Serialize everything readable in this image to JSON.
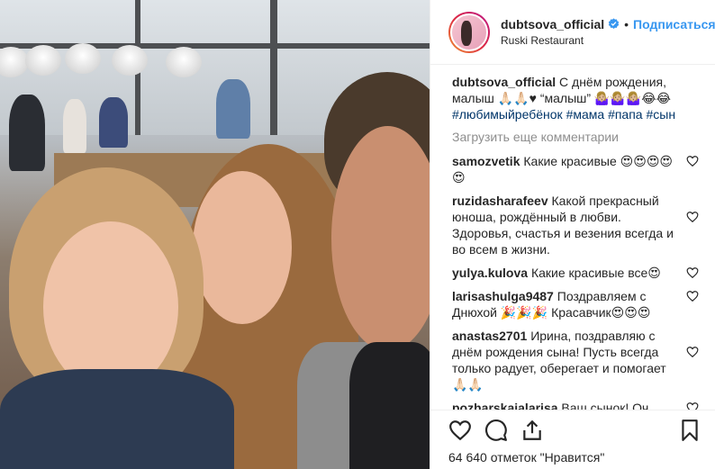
{
  "post": {
    "username": "dubtsova_official",
    "follow_label": "Подписаться",
    "location": "Ruski Restaurant",
    "dot": "•"
  },
  "caption": {
    "username": "dubtsova_official",
    "text": "С днём рождения, малыш 🙏🏻🙏🏻♥ “малыш” 🤷🏼‍♀️🤷🏼‍♀️🤷🏼‍♀️😂😂",
    "hashtags": [
      "#любимыйребёнок",
      "#мама",
      "#папа",
      "#сын"
    ]
  },
  "load_more": "Загрузить еще комментарии",
  "comments": [
    {
      "user": "samozvetik",
      "text": "Какие красивые 😍😍😍😍😍"
    },
    {
      "user": "ruzidasharafeev",
      "text": "Какой прекрасный юноша, рождённый в любви. Здоровья, счастья и везения всегда и во всем в жизни."
    },
    {
      "user": "yulya.kulova",
      "text": "Какие красивые все😍"
    },
    {
      "user": "larisashulga9487",
      "text": "Поздравляем с Днюхой 🎉🎉🎉 Красавчик😍😍😍"
    },
    {
      "user": "anastas2701",
      "text": "Ирина, поздравляю с днём рождения сына! Пусть всегда только радует, оберегает и помогает 🙏🏻🙏🏻"
    },
    {
      "user": "pozharskaialarisa",
      "text": "Ваш сынок! Оч"
    }
  ],
  "likes_text": "64 640 отметок \"Нравится\"",
  "colors": {
    "accent": "#3897f0",
    "hashtag": "#003569",
    "muted": "#8e8e8e",
    "text": "#262626"
  },
  "icons": {
    "verified": "verified-badge-icon",
    "like": "heart-icon",
    "comment": "comment-bubble-icon",
    "share": "share-upload-icon",
    "save": "bookmark-icon"
  }
}
